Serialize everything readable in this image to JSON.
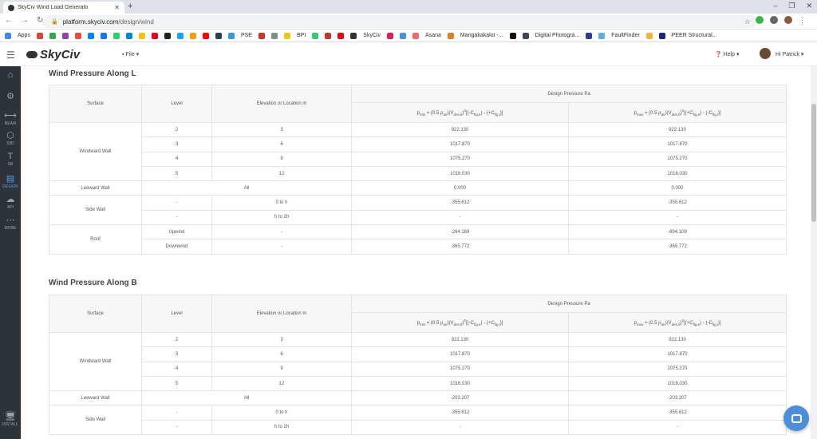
{
  "browser": {
    "tab_title": "SkyCiv Wind Load Generato",
    "url_host": "platform.skyciv.com",
    "url_path": "/design/wind",
    "bookmarks": [
      "Apps",
      "PSE",
      "BPI",
      "SkyCiv",
      "Asana",
      "Mangakakalot -...",
      "Digital Photogra...",
      "FaultFinder",
      "PEER Structural..."
    ]
  },
  "header": {
    "logo": "SkyCiv",
    "file_menu": "File",
    "help": "Help",
    "user": "Hi Patrick"
  },
  "sidebar": [
    {
      "label": "",
      "icon": "home-icon"
    },
    {
      "label": "",
      "icon": "gear-icon"
    },
    {
      "label": "BEAM",
      "icon": "beam-icon"
    },
    {
      "label": "S3D",
      "icon": "s3d-icon"
    },
    {
      "label": "SB",
      "icon": "sb-icon"
    },
    {
      "label": "DESIGN",
      "icon": "design-icon"
    },
    {
      "label": "API",
      "icon": "api-icon"
    },
    {
      "label": "MORE",
      "icon": "more-icon"
    },
    {
      "label": "INSTALL",
      "icon": "install-icon"
    }
  ],
  "colors": {
    "sidebar_bg": "#2d3339",
    "accent": "#4fa0e8"
  },
  "section_l": {
    "title": "Wind Pressure Along L",
    "headers": {
      "surface": "Surface",
      "level": "Level",
      "elevation": "Elevation or Location m",
      "design_pressure": "Design Pressure Pa"
    },
    "rows": {
      "windward": "Windward Wall",
      "ww": [
        {
          "level": "2",
          "elev": "3",
          "pmin": "922.130",
          "pmax": "922.130"
        },
        {
          "level": "3",
          "elev": "6",
          "pmin": "1017.870",
          "pmax": "1017.870"
        },
        {
          "level": "4",
          "elev": "9",
          "pmin": "1075.270",
          "pmax": "1075.270"
        },
        {
          "level": "5",
          "elev": "12",
          "pmin": "1016.030",
          "pmax": "1016.030"
        }
      ],
      "leeward": "Leeward Wall",
      "leeward_all": "All",
      "leeward_pmin": "0.000",
      "leeward_pmax": "0.000",
      "side": "Side Wall",
      "sw": [
        {
          "level": "-",
          "elev": "0 to h",
          "pmin": "-355.612",
          "pmax": "-355.612"
        },
        {
          "level": "-",
          "elev": "h to 2h",
          "pmin": "-",
          "pmax": "-"
        }
      ],
      "roof": "Roof",
      "rf": [
        {
          "level": "Upwind",
          "elev": "-",
          "pmin": "-264.169",
          "pmax": "-894.109"
        },
        {
          "level": "Downwind",
          "elev": "-",
          "pmin": "-365.772",
          "pmax": "-365.772"
        }
      ]
    }
  },
  "section_b": {
    "title": "Wind Pressure Along B",
    "headers": {
      "surface": "Surface",
      "level": "Level",
      "elevation": "Elevation or Location m",
      "design_pressure": "Design Pressure Pa"
    },
    "rows": {
      "windward": "Windward Wall",
      "ww": [
        {
          "level": "2",
          "elev": "3",
          "pmin": "922.130",
          "pmax": "922.130"
        },
        {
          "level": "3",
          "elev": "6",
          "pmin": "1017.870",
          "pmax": "1017.870"
        },
        {
          "level": "4",
          "elev": "9",
          "pmin": "1075.270",
          "pmax": "1075.270"
        },
        {
          "level": "5",
          "elev": "12",
          "pmin": "1016.030",
          "pmax": "1016.030"
        }
      ],
      "leeward": "Leeward Wall",
      "leeward_all": "All",
      "leeward_pmin": "-203.207",
      "leeward_pmax": "-203.207",
      "side": "Side Wall",
      "sw": [
        {
          "level": "-",
          "elev": "0 to h",
          "pmin": "-355.612",
          "pmax": "-355.612"
        },
        {
          "level": "-",
          "elev": "h to 2h",
          "pmin": "-",
          "pmax": "-"
        }
      ]
    }
  }
}
